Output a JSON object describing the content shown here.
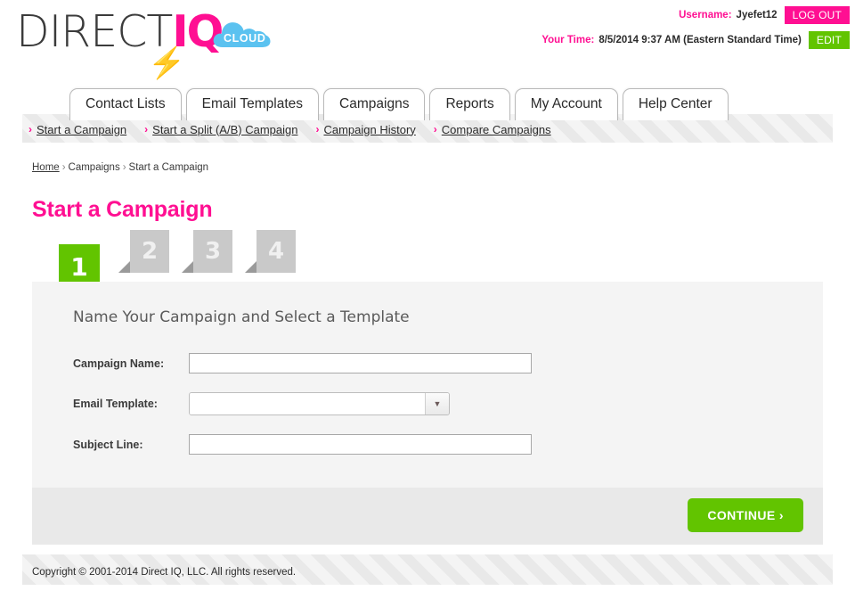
{
  "brand": {
    "name_part1": "DIRECT",
    "name_part2": "IQ",
    "cloud_label": "CLOUD",
    "bolt_icon": "lightning-bolt-icon",
    "pink": "#ff0f92",
    "green": "#62c400"
  },
  "account": {
    "username_label": "Username:",
    "username_value": "Jyefet12",
    "logout_label": "LOG OUT",
    "time_label": "Your Time:",
    "time_value": "8/5/2014 9:37 AM (Eastern Standard Time)",
    "edit_label": "EDIT"
  },
  "nav": {
    "tabs": [
      {
        "label": "Contact Lists"
      },
      {
        "label": "Email Templates"
      },
      {
        "label": "Campaigns"
      },
      {
        "label": "Reports"
      },
      {
        "label": "My Account"
      },
      {
        "label": "Help Center"
      }
    ]
  },
  "subnav": {
    "items": [
      {
        "label": "Start a Campaign"
      },
      {
        "label": "Start a Split (A/B) Campaign"
      },
      {
        "label": "Campaign History"
      },
      {
        "label": "Compare Campaigns"
      }
    ]
  },
  "breadcrumb": {
    "home": "Home",
    "sep1": "›",
    "level2": "Campaigns",
    "sep2": "›",
    "current": "Start a Campaign"
  },
  "page": {
    "title": "Start a Campaign"
  },
  "wizard": {
    "steps": [
      {
        "number": "1",
        "state": "active"
      },
      {
        "number": "2",
        "state": "inactive"
      },
      {
        "number": "3",
        "state": "inactive"
      },
      {
        "number": "4",
        "state": "inactive"
      }
    ],
    "heading": "Name Your Campaign and Select a Template",
    "fields": [
      {
        "label": "Campaign Name:",
        "value": "",
        "placeholder": "",
        "type": "text"
      },
      {
        "label": "Email Template:",
        "value": "",
        "placeholder": "",
        "type": "select"
      },
      {
        "label": "Subject Line:",
        "value": "",
        "placeholder": "",
        "type": "text"
      }
    ],
    "continue_label": "CONTINUE ›"
  },
  "footer": {
    "copyright": "Copyright © 2001-2014 Direct IQ, LLC. All rights reserved."
  }
}
